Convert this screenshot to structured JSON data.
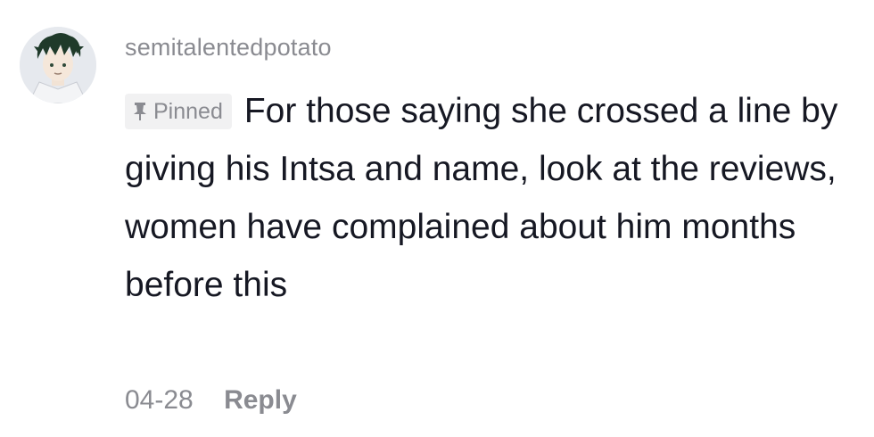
{
  "comment": {
    "username": "semitalentedpotato",
    "pinned_label": "Pinned",
    "text": "For those saying she crossed a line by giving his Intsa and name, look at the reviews, women have complained about him months before this",
    "date": "04-28",
    "reply_label": "Reply",
    "avatar_icon": "user-avatar-icon"
  },
  "colors": {
    "text_primary": "#161823",
    "text_secondary": "#8a8b91",
    "badge_bg": "#f1f1f2"
  }
}
